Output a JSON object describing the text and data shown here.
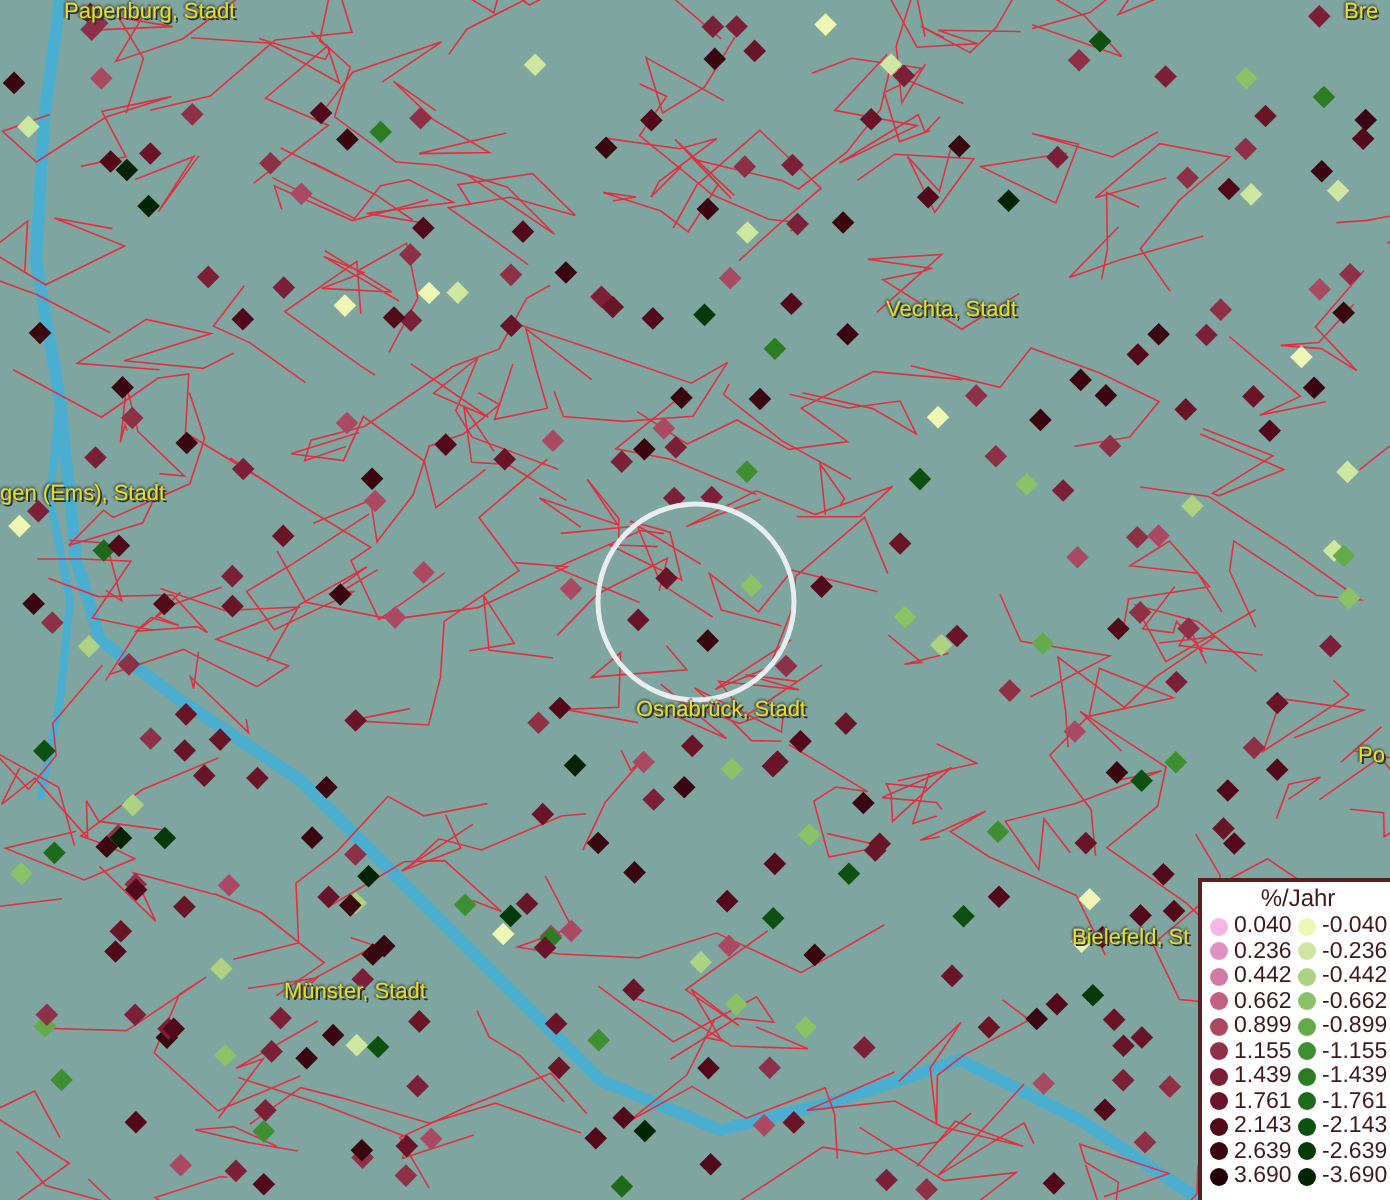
{
  "map": {
    "places": [
      {
        "name": "Papenburg, Stadt"
      },
      {
        "name": "Bre"
      },
      {
        "name": "Vechta, Stadt"
      },
      {
        "name": "gen (Ems), Stadt"
      },
      {
        "name": "Osnabrück, Stadt"
      },
      {
        "name": "Po"
      },
      {
        "name": "Bielefeld, St"
      },
      {
        "name": "Münster, Stadt"
      }
    ]
  },
  "legend": {
    "title": "%/Jahr",
    "rows": [
      {
        "positive": {
          "label": "0.040",
          "color": "#f4b6e6"
        },
        "negative": {
          "label": "-0.040",
          "color": "#eef6b4"
        }
      },
      {
        "positive": {
          "label": "0.236",
          "color": "#e290c4"
        },
        "negative": {
          "label": "-0.236",
          "color": "#cfe6a0"
        }
      },
      {
        "positive": {
          "label": "0.442",
          "color": "#d47aa8"
        },
        "negative": {
          "label": "-0.442",
          "color": "#acd282"
        }
      },
      {
        "positive": {
          "label": "0.662",
          "color": "#c26080"
        },
        "negative": {
          "label": "-0.662",
          "color": "#8cc266"
        }
      },
      {
        "positive": {
          "label": "0.899",
          "color": "#aa4a62"
        },
        "negative": {
          "label": "-0.899",
          "color": "#62aa4a"
        }
      },
      {
        "positive": {
          "label": "1.155",
          "color": "#8e3046"
        },
        "negative": {
          "label": "-1.155",
          "color": "#3e8e32"
        }
      },
      {
        "positive": {
          "label": "1.439",
          "color": "#7c2038"
        },
        "negative": {
          "label": "-1.439",
          "color": "#2c7c22"
        }
      },
      {
        "positive": {
          "label": "1.761",
          "color": "#6a1428"
        },
        "negative": {
          "label": "-1.761",
          "color": "#1c6a1a"
        }
      },
      {
        "positive": {
          "label": "2.143",
          "color": "#520a1a"
        },
        "negative": {
          "label": "-2.143",
          "color": "#0e5010"
        }
      },
      {
        "positive": {
          "label": "2.639",
          "color": "#3a0610"
        },
        "negative": {
          "label": "-2.639",
          "color": "#063a08"
        }
      },
      {
        "positive": {
          "label": "3.690",
          "color": "#220008"
        },
        "negative": {
          "label": "-3.690",
          "color": "#022402"
        }
      }
    ]
  }
}
